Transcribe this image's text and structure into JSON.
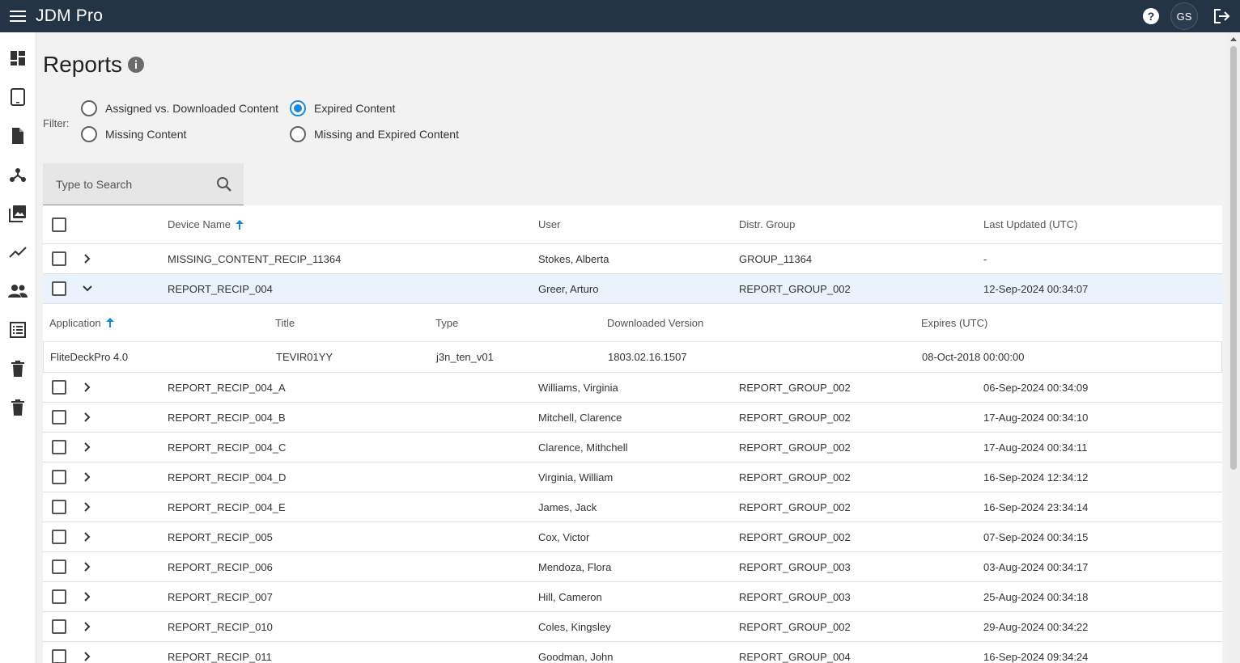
{
  "app": {
    "title": "JDM Pro",
    "avatar_initials": "GS"
  },
  "page": {
    "title": "Reports"
  },
  "filter": {
    "label": "Filter:",
    "options": [
      {
        "label": "Assigned vs. Downloaded Content",
        "checked": false
      },
      {
        "label": "Expired Content",
        "checked": true
      },
      {
        "label": "Missing Content",
        "checked": false
      },
      {
        "label": "Missing and Expired Content",
        "checked": false
      }
    ]
  },
  "search": {
    "placeholder": "Type to Search",
    "value": ""
  },
  "table": {
    "headers": {
      "device": "Device Name",
      "user": "User",
      "group": "Distr. Group",
      "updated": "Last Updated (UTC)"
    },
    "rows": [
      {
        "device": "MISSING_CONTENT_RECIP_11364",
        "user": "Stokes, Alberta",
        "group": "GROUP_11364",
        "updated": "-"
      },
      {
        "device": "REPORT_RECIP_004",
        "user": "Greer, Arturo",
        "group": "REPORT_GROUP_002",
        "updated": "12-Sep-2024 00:34:07"
      },
      {
        "device": "REPORT_RECIP_004_A",
        "user": "Williams, Virginia",
        "group": "REPORT_GROUP_002",
        "updated": "06-Sep-2024 00:34:09"
      },
      {
        "device": "REPORT_RECIP_004_B",
        "user": "Mitchell, Clarence",
        "group": "REPORT_GROUP_002",
        "updated": "17-Aug-2024 00:34:10"
      },
      {
        "device": "REPORT_RECIP_004_C",
        "user": "Clarence, Mithchell",
        "group": "REPORT_GROUP_002",
        "updated": "17-Aug-2024 00:34:11"
      },
      {
        "device": "REPORT_RECIP_004_D",
        "user": "Virginia, William",
        "group": "REPORT_GROUP_002",
        "updated": "16-Sep-2024 12:34:12"
      },
      {
        "device": "REPORT_RECIP_004_E",
        "user": "James, Jack",
        "group": "REPORT_GROUP_002",
        "updated": "16-Sep-2024 23:34:14"
      },
      {
        "device": "REPORT_RECIP_005",
        "user": "Cox, Victor",
        "group": "REPORT_GROUP_002",
        "updated": "07-Sep-2024 00:34:15"
      },
      {
        "device": "REPORT_RECIP_006",
        "user": "Mendoza, Flora",
        "group": "REPORT_GROUP_003",
        "updated": "03-Aug-2024 00:34:17"
      },
      {
        "device": "REPORT_RECIP_007",
        "user": "Hill, Cameron",
        "group": "REPORT_GROUP_003",
        "updated": "25-Aug-2024 00:34:18"
      },
      {
        "device": "REPORT_RECIP_010",
        "user": "Coles, Kingsley",
        "group": "REPORT_GROUP_002",
        "updated": "29-Aug-2024 00:34:22"
      },
      {
        "device": "REPORT_RECIP_011",
        "user": "Goodman, John",
        "group": "REPORT_GROUP_004",
        "updated": "16-Sep-2024 09:34:24"
      }
    ],
    "detail": {
      "headers": {
        "application": "Application",
        "title": "Title",
        "type": "Type",
        "version": "Downloaded Version",
        "expires": "Expires (UTC)"
      },
      "rows": [
        {
          "application": "FliteDeckPro 4.0",
          "title": "TEVIR01YY",
          "type": "j3n_ten_v01",
          "version": "1803.02.16.1507",
          "expires": "08-Oct-2018 00:00:00"
        }
      ]
    }
  },
  "colors": {
    "topbar": "#243447",
    "accent": "#1a8ad8",
    "expanded_row": "#eaf3fb"
  },
  "icons": {
    "topbar": [
      "menu-icon",
      "help-icon",
      "logout-icon"
    ],
    "sidebar": [
      "dashboard-icon",
      "tablet-icon",
      "document-icon",
      "network-icon",
      "photo-library-icon",
      "trending-icon",
      "people-icon",
      "list-icon",
      "trash-icon",
      "trash-icon"
    ]
  }
}
